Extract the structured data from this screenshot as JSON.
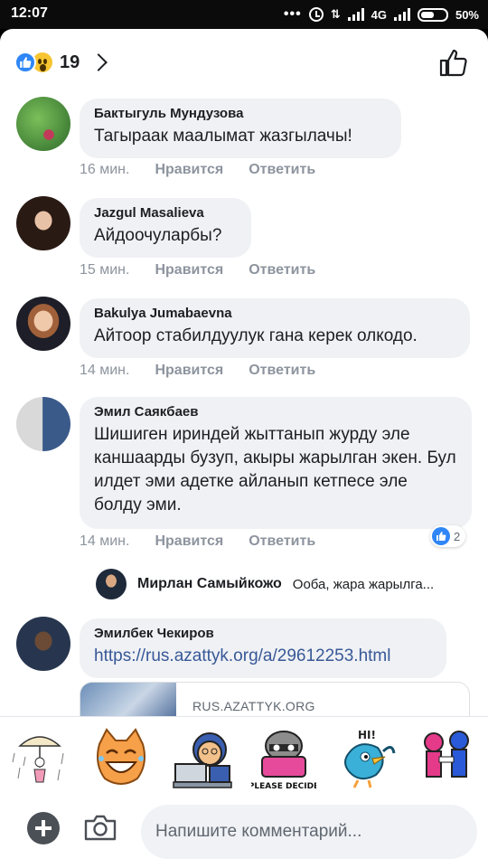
{
  "status_bar": {
    "time": "12:07",
    "network": "4G",
    "battery": "50%"
  },
  "header": {
    "reaction_count": "19",
    "reactions": [
      "like",
      "wow"
    ]
  },
  "comments": [
    {
      "author": "Бактыгуль Мундузова",
      "text": "Тагыраак маалымат жазгылачы!",
      "time": "16 мин.",
      "like_label": "Нравится",
      "reply_label": "Ответить"
    },
    {
      "author": "Jazgul Masalieva",
      "text": "Айдоочуларбы?",
      "time": "15 мин.",
      "like_label": "Нравится",
      "reply_label": "Ответить"
    },
    {
      "author": "Bakulya Jumabaevna",
      "text": "Айтоор стабилдуулук гана керек олкодо.",
      "time": "14 мин.",
      "like_label": "Нравится",
      "reply_label": "Ответить"
    },
    {
      "author": "Эмил Саякбаев",
      "text": "Шишиген ириндей жыттанып журду эле каншаарды бузуп, акыры жарылган экен. Бул илдет эми адетке айланып кетпесе эле болду эми.",
      "time": "14 мин.",
      "like_label": "Нравится",
      "reply_label": "Ответить",
      "reaction_count": "2",
      "reply": {
        "author": "Мирлан Самыйкожо",
        "text": "Ооба, жара жарылга..."
      }
    },
    {
      "author": "Эмилбек Чекиров",
      "text": "https://rus.azattyk.org/a/29612253.html",
      "link_domain": "RUS.AZATTYK.ORG"
    }
  ],
  "stickers": [
    "umbrella-girl-sticker",
    "laughing-cat-sticker",
    "laptop-guy-sticker",
    "please-decide-raccoon-sticker",
    "hi-bird-sticker",
    "power-rangers-sticker"
  ],
  "sticker_text": {
    "please_decide": "PLEASE DECIDE",
    "hi": "HI!"
  },
  "composer": {
    "placeholder": "Напишите комментарий..."
  },
  "colors": {
    "accent": "#2f86f6",
    "bubble": "#eff1f4",
    "meta": "#8d949e",
    "link": "#385898"
  }
}
